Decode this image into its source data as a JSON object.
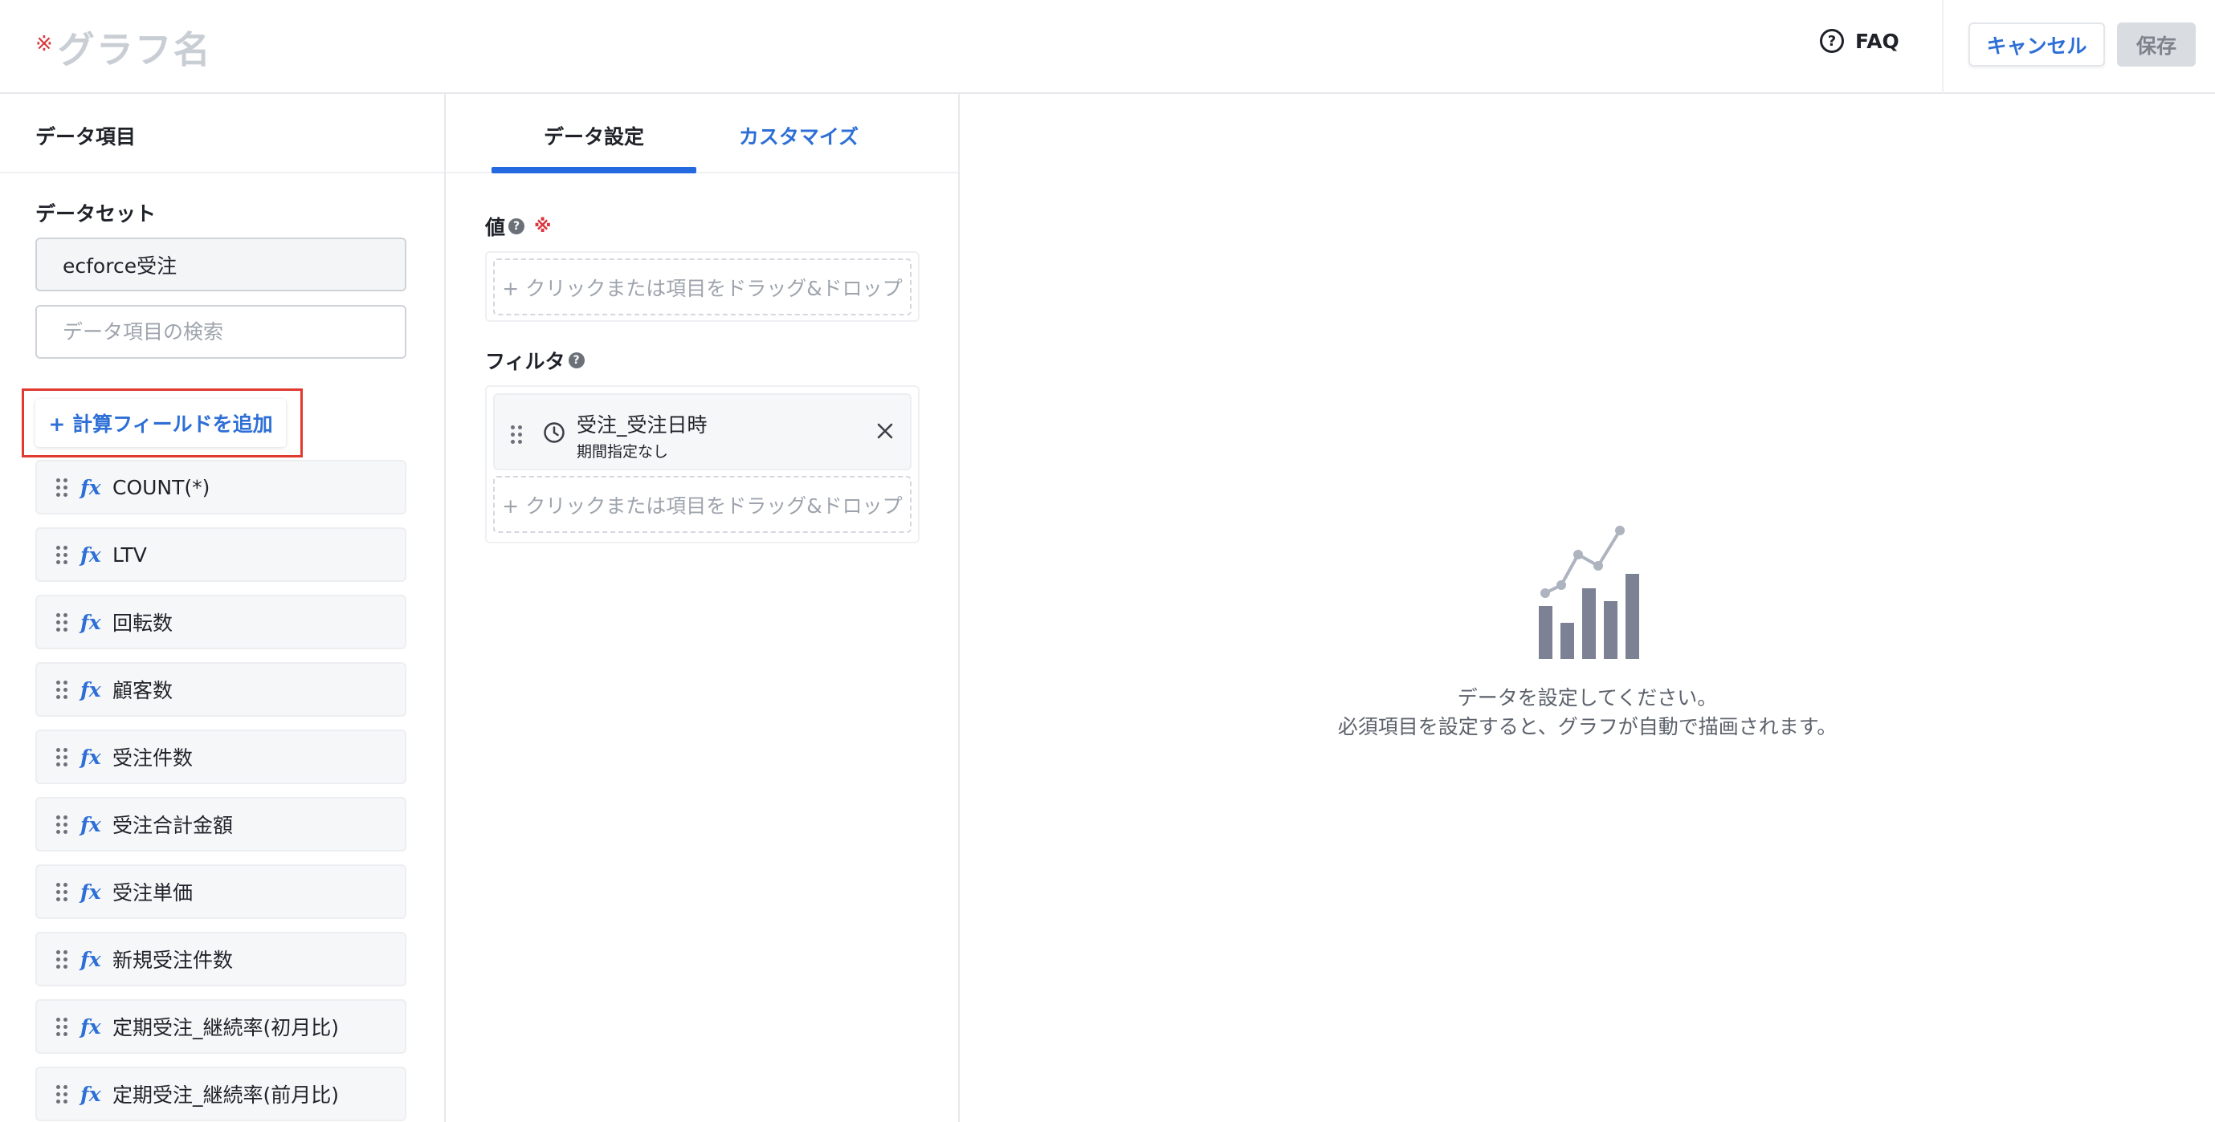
{
  "header": {
    "required_mark": "※",
    "title_placeholder": "グラフ名",
    "faq_label": "FAQ",
    "cancel_label": "キャンセル",
    "save_label": "保存"
  },
  "sidebar": {
    "heading": "データ項目",
    "dataset_label": "データセット",
    "dataset_value": "ecforce受注",
    "search_placeholder": "データ項目の検索",
    "add_field_label": "+ 計算フィールドを追加",
    "fx_symbol": "fx",
    "fields": [
      "COUNT(*)",
      "LTV",
      "回転数",
      "顧客数",
      "受注件数",
      "受注合計金額",
      "受注単価",
      "新規受注件数",
      "定期受注_継続率(初月比)",
      "定期受注_継続率(前月比)"
    ]
  },
  "config": {
    "tabs": [
      "データ設定",
      "カスタマイズ"
    ],
    "active_tab": "データ設定",
    "value_label": "値",
    "value_required_mark": "※",
    "help_symbol": "?",
    "drop_hint": "+ クリックまたは項目をドラッグ&ドロップ",
    "filter_label": "フィルタ",
    "filter": {
      "title": "受注_受注日時",
      "subtitle": "期間指定なし"
    }
  },
  "preview": {
    "line1": "データを設定してください。",
    "line2": "必須項目を設定すると、グラフが自動で描画されます。"
  },
  "colors": {
    "accent": "#2469e0",
    "link": "#2d6fd6",
    "required": "#d9363e",
    "highlight": "#e03a2f",
    "icon_gray": "#7c8294"
  }
}
